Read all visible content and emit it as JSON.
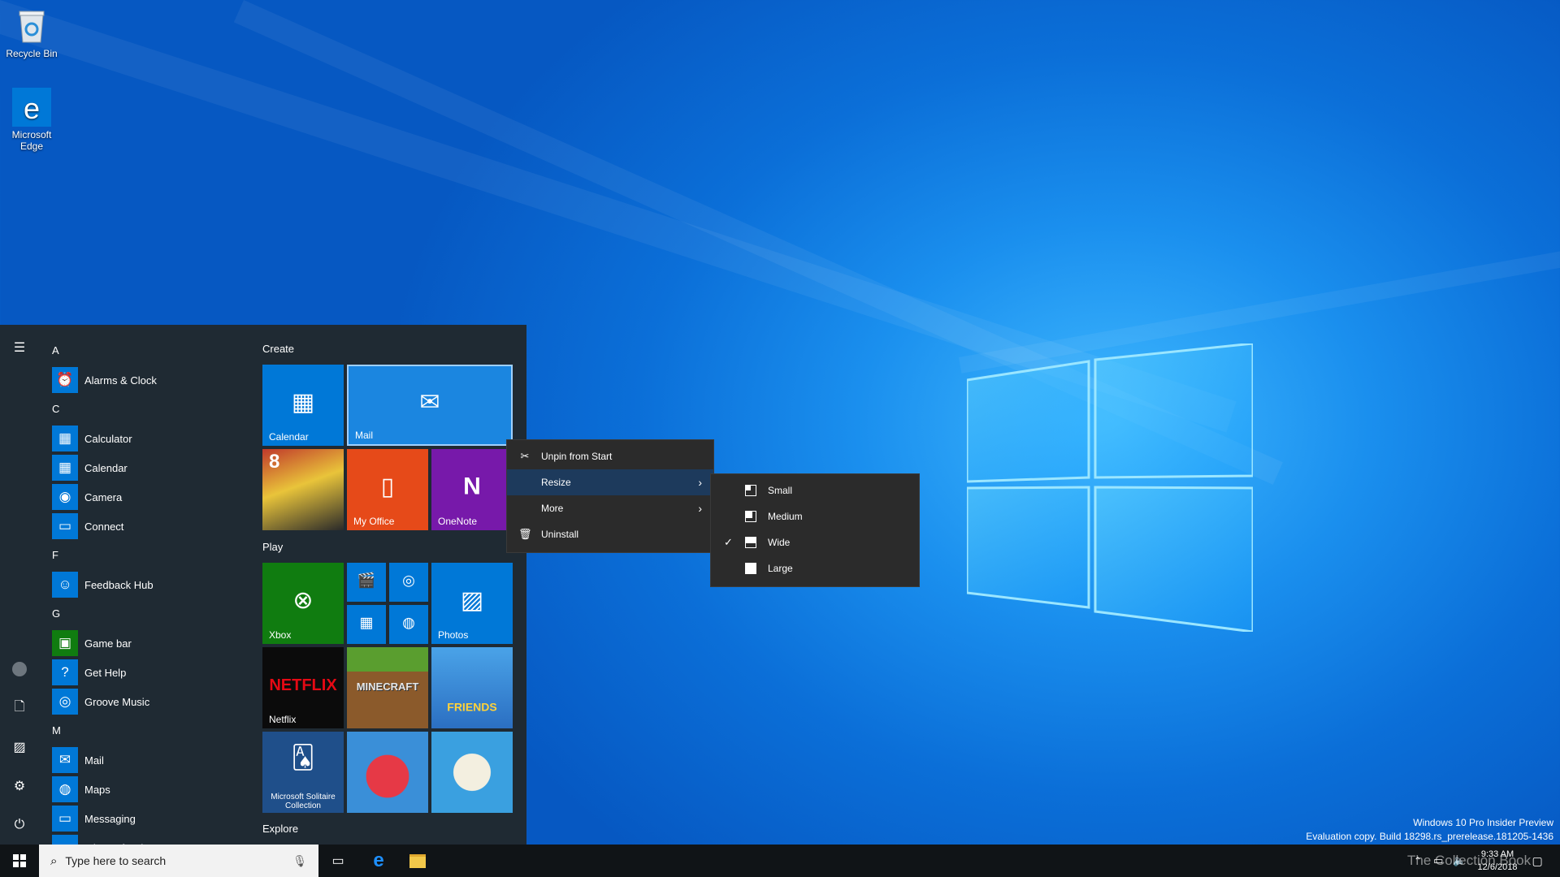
{
  "desktop": {
    "icons": [
      {
        "label": "Recycle Bin"
      },
      {
        "label": "Microsoft Edge"
      }
    ],
    "watermark": {
      "line1": "Windows 10 Pro Insider Preview",
      "line2": "Evaluation copy. Build 18298.rs_prerelease.181205-1436",
      "overlay": "The Collection Book"
    }
  },
  "start": {
    "rail": [
      "hamburger-icon",
      "user-icon",
      "documents-icon",
      "pictures-icon",
      "settings-icon",
      "power-icon"
    ],
    "apps": [
      {
        "type": "letter",
        "text": "A"
      },
      {
        "type": "app",
        "text": "Alarms & Clock",
        "icon": "⏰"
      },
      {
        "type": "letter",
        "text": "C"
      },
      {
        "type": "app",
        "text": "Calculator",
        "icon": "▦"
      },
      {
        "type": "app",
        "text": "Calendar",
        "icon": "▦"
      },
      {
        "type": "app",
        "text": "Camera",
        "icon": "◉"
      },
      {
        "type": "app",
        "text": "Connect",
        "icon": "▭"
      },
      {
        "type": "letter",
        "text": "F"
      },
      {
        "type": "app",
        "text": "Feedback Hub",
        "icon": "☺"
      },
      {
        "type": "letter",
        "text": "G"
      },
      {
        "type": "app",
        "text": "Game bar",
        "icon": "▣",
        "green": true
      },
      {
        "type": "app",
        "text": "Get Help",
        "icon": "?"
      },
      {
        "type": "app",
        "text": "Groove Music",
        "icon": "◎"
      },
      {
        "type": "letter",
        "text": "M"
      },
      {
        "type": "app",
        "text": "Mail",
        "icon": "✉"
      },
      {
        "type": "app",
        "text": "Maps",
        "icon": "◍"
      },
      {
        "type": "app",
        "text": "Messaging",
        "icon": "▭"
      },
      {
        "type": "app",
        "text": "Microsoft Edge",
        "icon": "e"
      }
    ],
    "groups": {
      "create": "Create",
      "play": "Play",
      "explore": "Explore"
    },
    "tiles": {
      "calendar": "Calendar",
      "mail": "Mail",
      "myoffice": "My Office",
      "onenote": "OneNote",
      "xbox": "Xbox",
      "photos": "Photos",
      "netflix": "Netflix",
      "netflix_logo": "NETFLIX",
      "minecraft_logo": "MINECRAFT",
      "friends_logo": "FRIENDS",
      "solitaire": "Microsoft Solitaire Collection",
      "asphalt_badge": "8"
    }
  },
  "context_menu": {
    "items": [
      {
        "label": "Unpin from Start",
        "icon": "unpin-icon"
      },
      {
        "label": "Resize",
        "submenu": true,
        "highlighted": true
      },
      {
        "label": "More",
        "submenu": true
      },
      {
        "label": "Uninstall",
        "icon": "trash-icon"
      }
    ],
    "resize_options": [
      {
        "label": "Small",
        "checked": false
      },
      {
        "label": "Medium",
        "checked": false
      },
      {
        "label": "Wide",
        "checked": true
      },
      {
        "label": "Large",
        "checked": false
      }
    ]
  },
  "taskbar": {
    "search_placeholder": "Type here to search",
    "time": "9:33 AM",
    "date": "12/6/2018"
  },
  "colors": {
    "accent": "#0078d7",
    "start_bg": "#1f2a33",
    "taskbar": "#101417"
  }
}
